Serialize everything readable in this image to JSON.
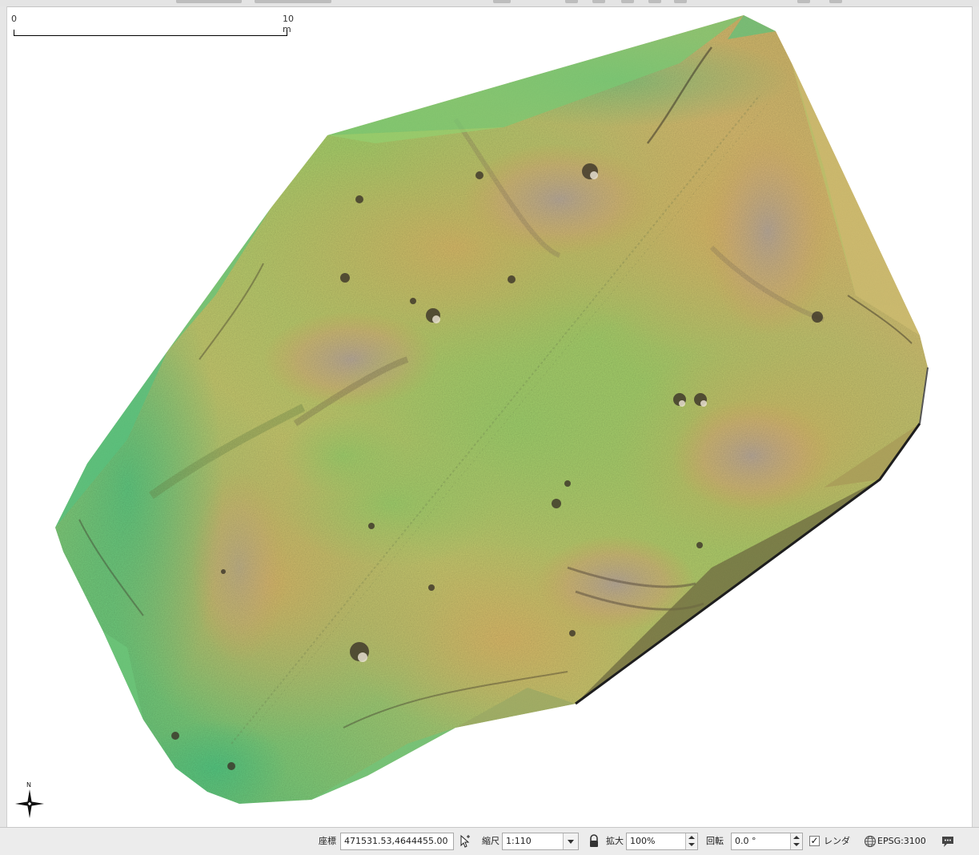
{
  "scalebar": {
    "start_label": "0",
    "end_label": "10 m"
  },
  "map": {
    "north_label": "N",
    "icon": "north-arrow-icon",
    "colors": {
      "low": "#3fbf7f",
      "mid": "#a7cf6a",
      "high": "#d9b266",
      "peak": "#b9a99a"
    }
  },
  "statusbar": {
    "coordinate_label": "座標",
    "coordinate_value": "471531.53,4644455.00",
    "scale_label": "縮尺",
    "scale_value": "1:110",
    "magnifier_label": "拡大",
    "magnifier_value": "100%",
    "rotation_label": "回転",
    "rotation_value": "0.0 °",
    "render_label": "レンダ",
    "render_checked": "✓",
    "crs_label": "EPSG:3100",
    "icons": {
      "coordinate_toggle": "mouse-pointer-icon",
      "lock": "lock-icon",
      "crs": "globe-icon",
      "messages": "message-bubble-icon"
    }
  }
}
